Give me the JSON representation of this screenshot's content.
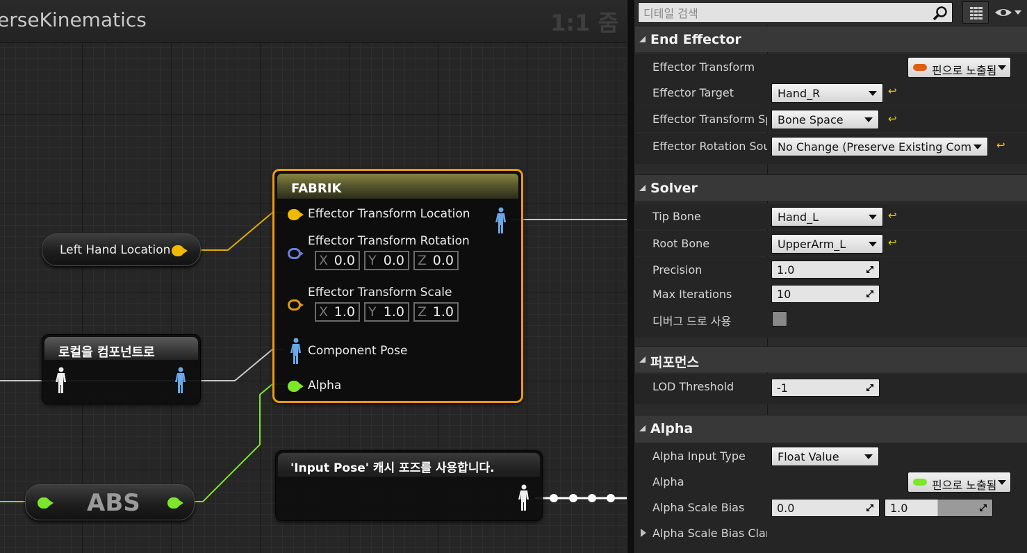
{
  "graph": {
    "title": "erseKinematics",
    "zoom": "1:1 줌",
    "nodes": {
      "left_hand": {
        "label": "Left Hand Location"
      },
      "local_to_component": {
        "title": "로컬을 컴포넌트로"
      },
      "abs": {
        "title": "ABS"
      },
      "fabrik": {
        "title": "FABRIK",
        "pins": {
          "location": "Effector Transform Location",
          "rotation": "Effector Transform Rotation",
          "scale": "Effector Transform Scale",
          "pose": "Component Pose",
          "alpha": "Alpha"
        },
        "rotation_vec": [
          {
            "axis": "X",
            "value": "0.0"
          },
          {
            "axis": "Y",
            "value": "0.0"
          },
          {
            "axis": "Z",
            "value": "0.0"
          }
        ],
        "scale_vec": [
          {
            "axis": "X",
            "value": "1.0"
          },
          {
            "axis": "Y",
            "value": "1.0"
          },
          {
            "axis": "Z",
            "value": "1.0"
          }
        ]
      },
      "cache_pose": {
        "title": "'Input Pose' 캐시 포즈를 사용합니다."
      }
    }
  },
  "details": {
    "search_placeholder": "디테일 검색",
    "categories": {
      "end_effector": {
        "label": "End Effector",
        "rows": {
          "transform": {
            "label": "Effector Transform",
            "value": "핀으로 노출됨",
            "chip_color": "#e25d12"
          },
          "target": {
            "label": "Effector Target",
            "value": "Hand_R"
          },
          "space": {
            "label": "Effector Transform Space",
            "value": "Bone Space"
          },
          "rotation_source": {
            "label": "Effector Rotation Source",
            "value": "No Change (Preserve Existing Component"
          }
        }
      },
      "solver": {
        "label": "Solver",
        "rows": {
          "tip_bone": {
            "label": "Tip Bone",
            "value": "Hand_L"
          },
          "root_bone": {
            "label": "Root Bone",
            "value": "UpperArm_L"
          },
          "precision": {
            "label": "Precision",
            "value": "1.0"
          },
          "max_iterations": {
            "label": "Max Iterations",
            "value": "10"
          },
          "debug_draw": {
            "label": "디버그 드로 사용",
            "checked": false
          }
        }
      },
      "performance": {
        "label": "퍼포먼스",
        "rows": {
          "lod": {
            "label": "LOD Threshold",
            "value": "-1"
          }
        }
      },
      "alpha": {
        "label": "Alpha",
        "rows": {
          "input_type": {
            "label": "Alpha Input Type",
            "value": "Float Value"
          },
          "alpha": {
            "label": "Alpha",
            "value": "핀으로 노출됨",
            "chip_color": "#7ce629"
          },
          "scale_bias": {
            "label": "Alpha Scale Bias",
            "min": "0.0",
            "max": "1.0"
          },
          "scale_bias_clamp": {
            "label": "Alpha Scale Bias Clamp"
          }
        }
      }
    }
  },
  "colors": {
    "exec_yellow": "#f0b800",
    "alpha_green": "#7ce629",
    "fabrik_border": "#f09a0c",
    "pose_blue": "#6aa8e8"
  }
}
